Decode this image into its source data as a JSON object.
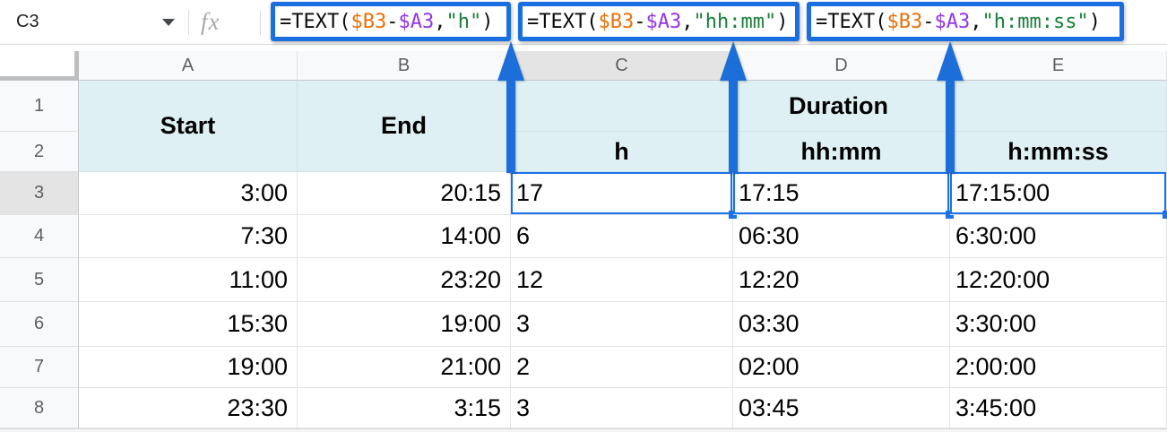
{
  "formula_bar": {
    "cell_reference": "C3",
    "fx_label": "fx",
    "formulas": [
      {
        "target_column": "C",
        "parts": [
          "=TEXT(",
          "$B3",
          "-",
          "$A3",
          ",",
          "\"h\"",
          ")"
        ]
      },
      {
        "target_column": "D",
        "parts": [
          "=TEXT(",
          "$B3",
          "-",
          "$A3",
          ",",
          "\"hh:mm\"",
          ")"
        ]
      },
      {
        "target_column": "E",
        "parts": [
          "=TEXT(",
          "$B3",
          "-",
          "$A3",
          ",",
          "\"h:mm:ss\"",
          ")"
        ]
      }
    ],
    "syntax_colors": {
      "reference1": "#e8710a",
      "reference2": "#9334e6",
      "string": "#188038",
      "default": "#000000"
    }
  },
  "sheet": {
    "column_letters": [
      "A",
      "B",
      "C",
      "D",
      "E"
    ],
    "row_numbers": [
      1,
      2,
      3,
      4,
      5,
      6,
      7,
      8
    ],
    "selected_column": "C",
    "selected_row_header": 3,
    "selected_cells": [
      "C3",
      "D3",
      "E3"
    ],
    "headers": {
      "start": "Start",
      "end": "End",
      "duration": "Duration",
      "fmt_h": "h",
      "fmt_hh_mm": "hh:mm",
      "fmt_h_mm_ss": "h:mm:ss"
    },
    "rows": [
      {
        "n": 3,
        "start": "3:00",
        "end": "20:15",
        "h": "17",
        "hh_mm": "17:15",
        "h_mm_ss": "17:15:00"
      },
      {
        "n": 4,
        "start": "7:30",
        "end": "14:00",
        "h": "6",
        "hh_mm": "06:30",
        "h_mm_ss": "6:30:00"
      },
      {
        "n": 5,
        "start": "11:00",
        "end": "23:20",
        "h": "12",
        "hh_mm": "12:20",
        "h_mm_ss": "12:20:00"
      },
      {
        "n": 6,
        "start": "15:30",
        "end": "19:00",
        "h": "3",
        "hh_mm": "03:30",
        "h_mm_ss": "3:30:00"
      },
      {
        "n": 7,
        "start": "19:00",
        "end": "21:00",
        "h": "2",
        "hh_mm": "02:00",
        "h_mm_ss": "2:00:00"
      },
      {
        "n": 8,
        "start": "23:30",
        "end": "3:15",
        "h": "3",
        "hh_mm": "03:45",
        "h_mm_ss": "3:45:00"
      }
    ],
    "colors": {
      "accent_blue": "#1a73e8",
      "header_fill": "#def0f3",
      "gridline": "#e2e3e5",
      "header_bar_fill": "#f8f9fa",
      "selected_header_fill": "#e4e4e4"
    }
  }
}
